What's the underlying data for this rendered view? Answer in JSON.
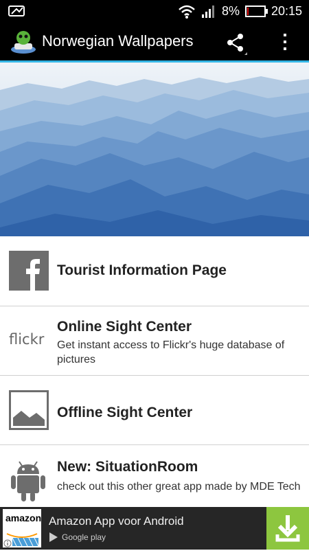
{
  "status_bar": {
    "battery_text": "8%",
    "battery_level": 0.08,
    "time": "20:15"
  },
  "action_bar": {
    "title": "Norwegian Wallpapers"
  },
  "list_items": [
    {
      "title": "Tourist Information Page",
      "subtitle": ""
    },
    {
      "title": "Online Sight Center",
      "subtitle": "Get instant access to Flickr's huge database of pictures",
      "icon_text": "flickr"
    },
    {
      "title": "Offline Sight Center",
      "subtitle": ""
    },
    {
      "title": "New: SituationRoom",
      "subtitle": "check out this other great app made by MDE Tech"
    }
  ],
  "ad": {
    "logo_text": "amazon",
    "title": "Amazon App voor Android",
    "store_label": "Google play"
  },
  "colors": {
    "accent": "#33b5e5",
    "ad_download": "#8dc63f",
    "battery_low": "#e21111"
  }
}
